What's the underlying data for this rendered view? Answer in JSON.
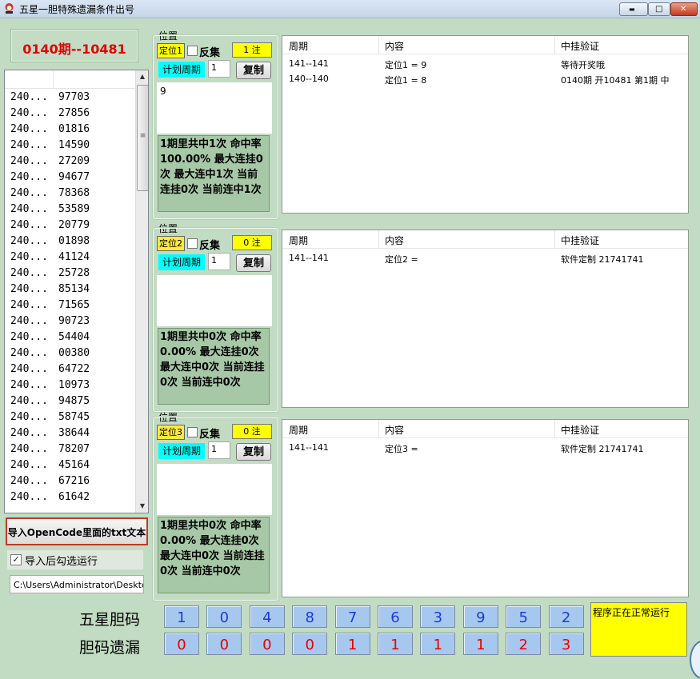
{
  "window": {
    "title": "五星一胆特殊遗漏条件出号",
    "min_glyph": "▬",
    "max_glyph": "□",
    "close_glyph": "✕"
  },
  "issue_label": "0140期--10481",
  "history": {
    "rows": [
      {
        "period": "240...",
        "code": "97703"
      },
      {
        "period": "240...",
        "code": "27856"
      },
      {
        "period": "240...",
        "code": "01816"
      },
      {
        "period": "240...",
        "code": "14590"
      },
      {
        "period": "240...",
        "code": "27209"
      },
      {
        "period": "240...",
        "code": "94677"
      },
      {
        "period": "240...",
        "code": "78368"
      },
      {
        "period": "240...",
        "code": "53589"
      },
      {
        "period": "240...",
        "code": "20779"
      },
      {
        "period": "240...",
        "code": "01898"
      },
      {
        "period": "240...",
        "code": "41124"
      },
      {
        "period": "240...",
        "code": "25728"
      },
      {
        "period": "240...",
        "code": "85134"
      },
      {
        "period": "240...",
        "code": "71565"
      },
      {
        "period": "240...",
        "code": "90723"
      },
      {
        "period": "240...",
        "code": "54404"
      },
      {
        "period": "240...",
        "code": "00380"
      },
      {
        "period": "240...",
        "code": "64722"
      },
      {
        "period": "240...",
        "code": "10973"
      },
      {
        "period": "240...",
        "code": "94875"
      },
      {
        "period": "240...",
        "code": "58745"
      },
      {
        "period": "240...",
        "code": "38644"
      },
      {
        "period": "240...",
        "code": "78207"
      },
      {
        "period": "240...",
        "code": "45164"
      },
      {
        "period": "240...",
        "code": "67216"
      },
      {
        "period": "240...",
        "code": "61642"
      }
    ],
    "scroll_up_glyph": "▲",
    "scroll_down_glyph": "▼",
    "scroll_grip_glyph": "≡"
  },
  "import_button": "导入OpenCode里面的txt文本",
  "auto_run": {
    "checked_glyph": "✓",
    "label": "导入后勾选运行"
  },
  "file_path": "C:\\Users\\Administrator\\Deskto",
  "panels": [
    {
      "caption": "位置",
      "position_tag": "定位1",
      "reverse_label": "反集",
      "count": "1 注",
      "plan_label": "计划周期",
      "plan_value": "1",
      "copy_label": "复制",
      "input_text": "9",
      "stats": "1期里共中1次 命中率100.00% 最大连挂0次 最大连中1次 当前连挂0次 当前连中1次"
    },
    {
      "caption": "位置",
      "position_tag": "定位2",
      "reverse_label": "反集",
      "count": "0 注",
      "plan_label": "计划周期",
      "plan_value": "1",
      "copy_label": "复制",
      "input_text": "",
      "stats": "1期里共中0次 命中率0.00% 最大连挂0次 最大连中0次 当前连挂0次 当前连中0次"
    },
    {
      "caption": "位置",
      "position_tag": "定位3",
      "reverse_label": "反集",
      "count": "0 注",
      "plan_label": "计划周期",
      "plan_value": "1",
      "copy_label": "复制",
      "input_text": "",
      "stats": "1期里共中0次 命中率0.00% 最大连挂0次 最大连中0次 当前连挂0次 当前连中0次"
    }
  ],
  "result_headers": [
    "周期",
    "内容",
    "中挂验证"
  ],
  "results": [
    {
      "rows": [
        {
          "period": "141--141",
          "content": "定位1 = 9",
          "verify": "等待开奖哦"
        },
        {
          "period": "140--140",
          "content": "定位1 = 8",
          "verify": "0140期 开10481 第1期 中"
        }
      ]
    },
    {
      "rows": [
        {
          "period": "141--141",
          "content": "定位2 =",
          "verify": "软件定制 21741741"
        }
      ]
    },
    {
      "rows": [
        {
          "period": "141--141",
          "content": "定位3 =",
          "verify": "软件定制 21741741"
        }
      ]
    }
  ],
  "bottom": {
    "row1_label": "五星胆码",
    "row1": [
      "1",
      "0",
      "4",
      "8",
      "7",
      "6",
      "3",
      "9",
      "5",
      "2"
    ],
    "row2_label": "胆码遗漏",
    "row2": [
      "0",
      "0",
      "0",
      "0",
      "1",
      "1",
      "1",
      "1",
      "2",
      "3"
    ]
  },
  "status": "程序正在正常运行",
  "colors": {
    "background": "#c2dcc3",
    "issue_text": "#e50000",
    "count_bg": "#ffff00",
    "plan_bg": "#00ffff",
    "number_box": "#a6c8ef",
    "number_blue": "#1c3bd6",
    "number_red": "#e50000",
    "status_bg": "#ffff00"
  }
}
